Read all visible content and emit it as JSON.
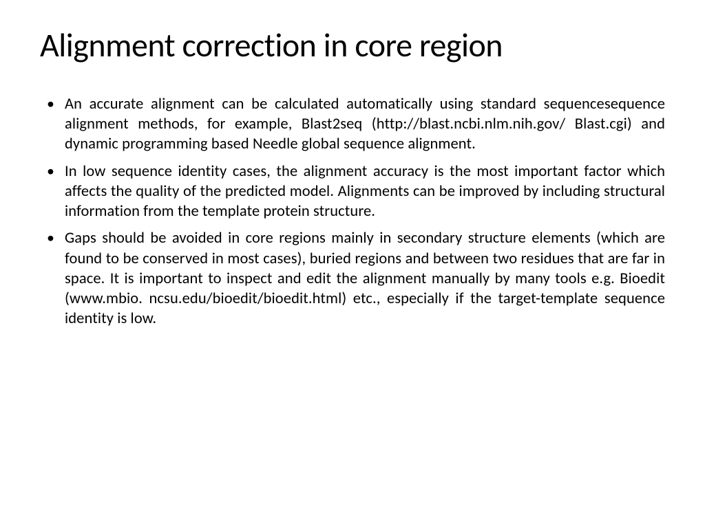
{
  "slide": {
    "title": "Alignment correction in core region",
    "bullets": [
      "An accurate alignment can be calculated automatically using standard sequencesequence alignment methods, for example, Blast2seq (http://blast.ncbi.nlm.nih.gov/ Blast.cgi) and dynamic programming based Needle global sequence alignment.",
      "In low sequence identity cases, the alignment accuracy is the most important factor which affects the quality of the predicted model. Alignments can be improved by including structural information from the template protein structure.",
      "Gaps should be avoided in core regions mainly in secondary structure elements (which are found to be conserved in most cases), buried regions and between two residues that are far in space. It is important to inspect and edit the alignment manually by many tools e.g. Bioedit (www.mbio. ncsu.edu/bioedit/bioedit.html) etc., especially if the target-template sequence identity is low."
    ]
  }
}
